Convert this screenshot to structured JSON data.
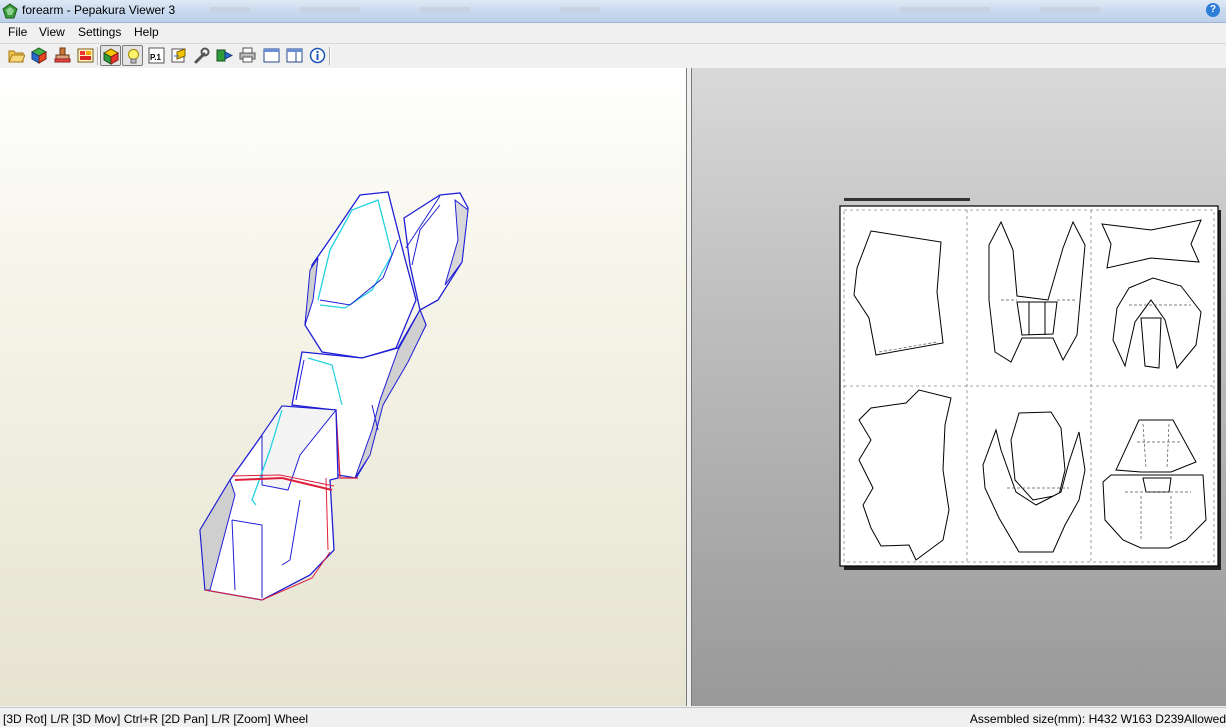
{
  "window": {
    "title": "forearm - Pepakura Viewer 3"
  },
  "menu": {
    "items": [
      "File",
      "View",
      "Settings",
      "Help"
    ]
  },
  "toolbar": {
    "buttons": [
      "open-icon",
      "cube-icon",
      "stamp-icon",
      "texture-icon",
      "color-cube-icon",
      "lightbulb-icon",
      "page-number-icon",
      "print-settings-icon",
      "wrench-icon",
      "export-icon",
      "printer-icon",
      "single-pane-icon",
      "dual-pane-icon",
      "info-icon"
    ],
    "page_number_label": "P.1",
    "pressed": [
      "color-cube-icon",
      "lightbulb-icon"
    ]
  },
  "status": {
    "left": "[3D Rot] L/R [3D Mov] Ctrl+R [2D Pan] L/R [Zoom] Wheel",
    "right": "Assembled size(mm): H432 W163 D239Allowed"
  },
  "colors": {
    "edge_blue": "#1f1fd6",
    "edge_cyan": "#22d3e0",
    "edge_red": "#e0203a",
    "accent_title": "#c9daee"
  }
}
